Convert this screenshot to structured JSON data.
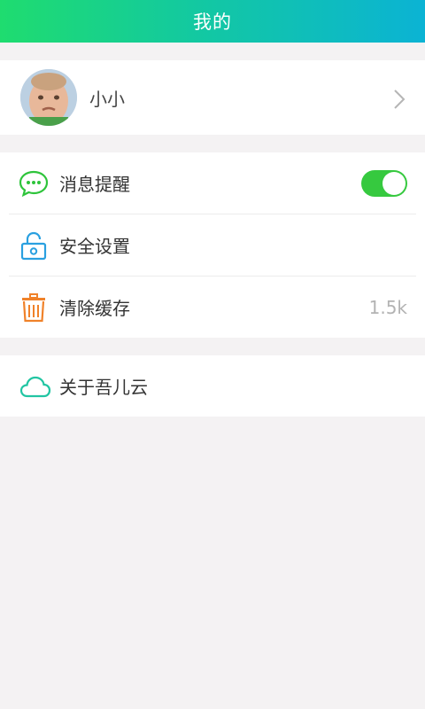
{
  "header": {
    "title": "我的"
  },
  "profile": {
    "name": "小小"
  },
  "settings": [
    {
      "label": "消息提醒",
      "icon": "chat-bubble-icon",
      "toggle_on": true
    },
    {
      "label": "安全设置",
      "icon": "lock-icon"
    },
    {
      "label": "清除缓存",
      "icon": "trash-icon",
      "value": "1.5k"
    }
  ],
  "about": {
    "label": "关于吾儿云",
    "icon": "cloud-icon"
  },
  "colors": {
    "header_start": "#1fdc6f",
    "header_end": "#0bb3d4",
    "toggle_on": "#36c93f",
    "chat_icon": "#2ec43b",
    "lock_icon": "#2aa0e0",
    "trash_icon": "#f0822a",
    "cloud_icon": "#22c5a3"
  }
}
